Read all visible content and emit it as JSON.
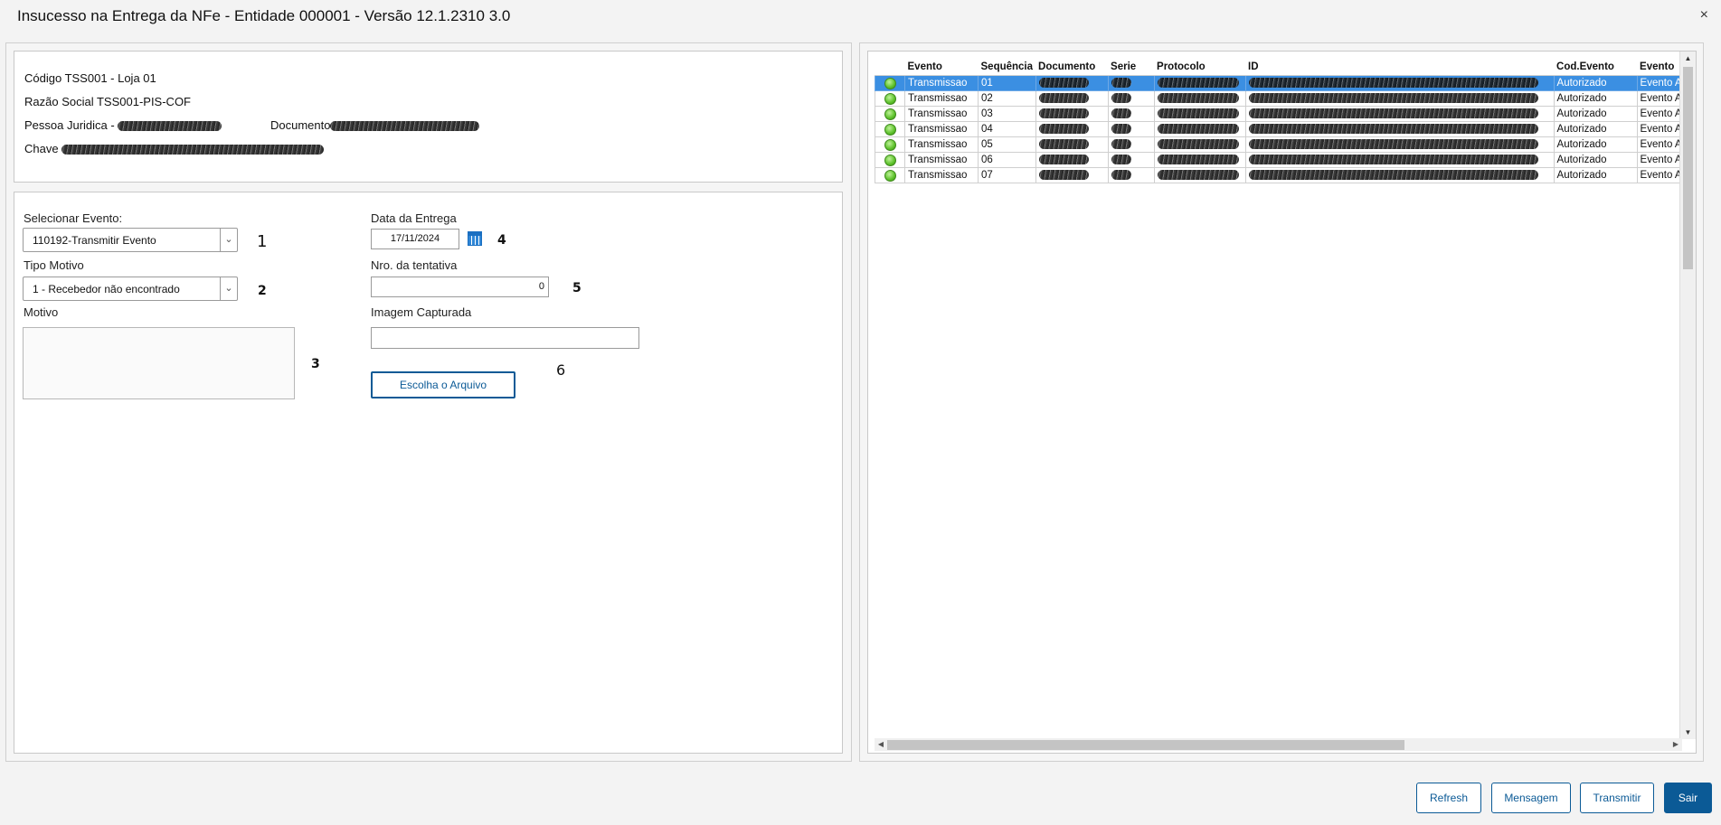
{
  "window": {
    "title": "Insucesso na Entrega da NFe - Entidade 000001 - Versão 12.1.2310  3.0",
    "close_symbol": "×"
  },
  "info": {
    "codigo": "Código TSS001 - Loja 01",
    "razao_social": "Razão Social TSS001-PIS-COF",
    "pessoa_juridica_label": "Pessoa Juridica -",
    "documento_label": "Documento",
    "chave_label": "Chave"
  },
  "form": {
    "selecionar_evento": {
      "label": "Selecionar Evento:",
      "value": "110192-Transmitir Evento",
      "marker": "1"
    },
    "tipo_motivo": {
      "label": "Tipo Motivo",
      "value": "1 - Recebedor não encontrado",
      "marker": "2"
    },
    "motivo": {
      "label": "Motivo",
      "value": "",
      "marker": "3"
    },
    "data_entrega": {
      "label": "Data da Entrega",
      "value": "17/11/2024",
      "marker": "4"
    },
    "nro_tentativa": {
      "label": "Nro. da tentativa",
      "value": "0",
      "marker": "5"
    },
    "imagem_capturada": {
      "label": "Imagem Capturada",
      "value": "",
      "marker": "6"
    },
    "escolha_arquivo_label": "Escolha o Arquivo"
  },
  "grid": {
    "columns": [
      "",
      "Evento",
      "Sequência",
      "Documento",
      "Serie",
      "Protocolo",
      "ID",
      "Cod.Evento",
      "Evento"
    ],
    "rows": [
      {
        "evento": "Transmissao",
        "sequencia": "01",
        "cod_evento": "Autorizado",
        "evento2": "Evento Aut"
      },
      {
        "evento": "Transmissao",
        "sequencia": "02",
        "cod_evento": "Autorizado",
        "evento2": "Evento Aut"
      },
      {
        "evento": "Transmissao",
        "sequencia": "03",
        "cod_evento": "Autorizado",
        "evento2": "Evento Aut"
      },
      {
        "evento": "Transmissao",
        "sequencia": "04",
        "cod_evento": "Autorizado",
        "evento2": "Evento Aut"
      },
      {
        "evento": "Transmissao",
        "sequencia": "05",
        "cod_evento": "Autorizado",
        "evento2": "Evento Aut"
      },
      {
        "evento": "Transmissao",
        "sequencia": "06",
        "cod_evento": "Autorizado",
        "evento2": "Evento Aut"
      },
      {
        "evento": "Transmissao",
        "sequencia": "07",
        "cod_evento": "Autorizado",
        "evento2": "Evento Aut"
      }
    ],
    "selected_row": 0
  },
  "buttons": {
    "refresh": "Refresh",
    "mensagem": "Mensagem",
    "transmitir": "Transmitir",
    "sair": "Sair"
  },
  "colors": {
    "accent": "#0b5a96",
    "selection": "#3b8fe2",
    "status_ok": "#5cc12a"
  }
}
